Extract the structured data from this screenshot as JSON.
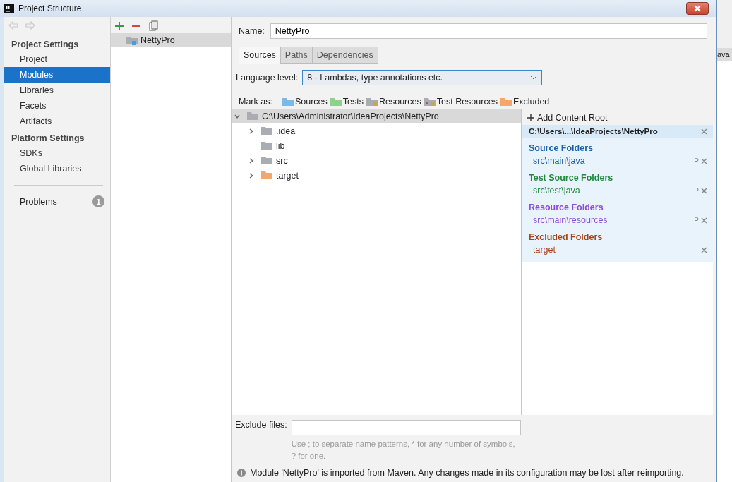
{
  "window": {
    "title": "Project Structure"
  },
  "sidebar": {
    "sections": [
      {
        "title": "Project Settings",
        "items": [
          {
            "label": "Project",
            "selected": false
          },
          {
            "label": "Modules",
            "selected": true
          },
          {
            "label": "Libraries",
            "selected": false
          },
          {
            "label": "Facets",
            "selected": false
          },
          {
            "label": "Artifacts",
            "selected": false
          }
        ]
      },
      {
        "title": "Platform Settings",
        "items": [
          {
            "label": "SDKs",
            "selected": false
          },
          {
            "label": "Global Libraries",
            "selected": false
          }
        ]
      }
    ],
    "problems": {
      "label": "Problems",
      "count": "1"
    }
  },
  "modules": [
    {
      "label": "NettyPro",
      "selected": true
    }
  ],
  "name_field": {
    "label": "Name:",
    "value": "NettyPro"
  },
  "tabs": [
    {
      "label": "Sources",
      "selected": true
    },
    {
      "label": "Paths",
      "selected": false
    },
    {
      "label": "Dependencies",
      "selected": false
    }
  ],
  "language_level": {
    "label": "Language level:",
    "value": "8 - Lambdas, type annotations etc."
  },
  "mark_as": {
    "label": "Mark as:",
    "items": [
      {
        "label": "Sources",
        "kind": "sources"
      },
      {
        "label": "Tests",
        "kind": "tests"
      },
      {
        "label": "Resources",
        "kind": "resources"
      },
      {
        "label": "Test Resources",
        "kind": "test-resources"
      },
      {
        "label": "Excluded",
        "kind": "excluded"
      }
    ]
  },
  "tree": [
    {
      "label": "C:\\Users\\Administrator\\IdeaProjects\\NettyPro",
      "kind": "folder",
      "expandable": true,
      "expanded": true,
      "selected": true,
      "children": [
        {
          "label": ".idea",
          "kind": "folder",
          "expandable": true,
          "expanded": false,
          "selected": false
        },
        {
          "label": "lib",
          "kind": "folder",
          "expandable": false,
          "expanded": false,
          "selected": false
        },
        {
          "label": "src",
          "kind": "folder",
          "expandable": true,
          "expanded": false,
          "selected": false
        },
        {
          "label": "target",
          "kind": "excluded",
          "expandable": true,
          "expanded": false,
          "selected": false
        }
      ]
    }
  ],
  "content_roots": {
    "add_label": "Add Content Root",
    "root": "C:\\Users\\...\\IdeaProjects\\NettyPro",
    "groups": [
      {
        "title": "Source Folders",
        "color": "#1f5fa8",
        "entries": [
          {
            "path": "src\\main\\java",
            "properties": "P"
          }
        ]
      },
      {
        "title": "Test Source Folders",
        "color": "#1f8a3c",
        "entries": [
          {
            "path": "src\\test\\java",
            "properties": "P"
          }
        ]
      },
      {
        "title": "Resource Folders",
        "color": "#8a4fd6",
        "entries": [
          {
            "path": "src\\main\\resources",
            "properties": "P"
          }
        ]
      },
      {
        "title": "Excluded Folders",
        "color": "#a8421a",
        "entries": [
          {
            "path": "target"
          }
        ]
      }
    ]
  },
  "exclude_files": {
    "label": "Exclude files:",
    "hint": "Use ; to separate name patterns, * for any number of symbols, ? for one."
  },
  "status_message": "Module 'NettyPro' is imported from Maven. Any changes made in its configuration may be lost after reimporting.",
  "background_window": {
    "tab_text": "ava"
  }
}
